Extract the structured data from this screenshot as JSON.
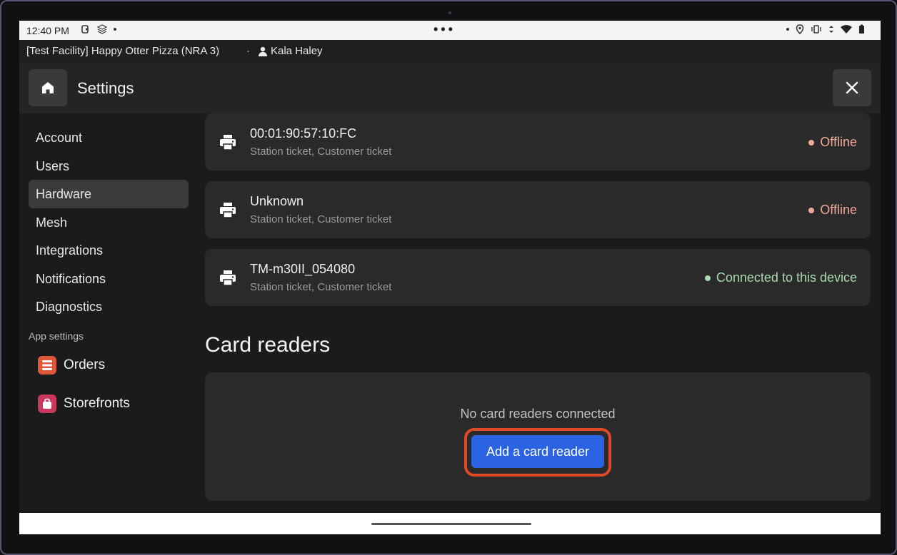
{
  "status_bar": {
    "time": "12:40 PM",
    "center_dots": "•••"
  },
  "facility_bar": {
    "facility": "[Test Facility] Happy Otter Pizza (NRA 3)",
    "separator": "·",
    "user": "Kala Haley"
  },
  "header": {
    "title": "Settings",
    "home_icon": "home-icon",
    "close_icon": "close-icon"
  },
  "sidebar": {
    "items": [
      {
        "label": "Account",
        "active": false
      },
      {
        "label": "Users",
        "active": false
      },
      {
        "label": "Hardware",
        "active": true
      },
      {
        "label": "Mesh",
        "active": false
      },
      {
        "label": "Integrations",
        "active": false
      },
      {
        "label": "Notifications",
        "active": false
      },
      {
        "label": "Diagnostics",
        "active": false
      }
    ],
    "section_label": "App settings",
    "apps": [
      {
        "label": "Orders",
        "icon": "orders-icon",
        "color": "#e0563a"
      },
      {
        "label": "Storefronts",
        "icon": "storefronts-icon",
        "color": "#c8385c"
      }
    ]
  },
  "printers": [
    {
      "name": "00:01:90:57:10:FC",
      "tickets": "Station ticket, Customer ticket",
      "status": "Offline",
      "status_color": "#f0a89a"
    },
    {
      "name": "Unknown",
      "tickets": "Station ticket, Customer ticket",
      "status": "Offline",
      "status_color": "#f0a89a"
    },
    {
      "name": "TM-m30II_054080",
      "tickets": "Station ticket, Customer ticket",
      "status": "Connected to this device",
      "status_color": "#a8dcb0"
    }
  ],
  "card_readers": {
    "title": "Card readers",
    "empty_text": "No card readers connected",
    "add_button": "Add a card reader"
  },
  "colors": {
    "accent": "#2b63e3",
    "highlight": "#e04a26"
  }
}
